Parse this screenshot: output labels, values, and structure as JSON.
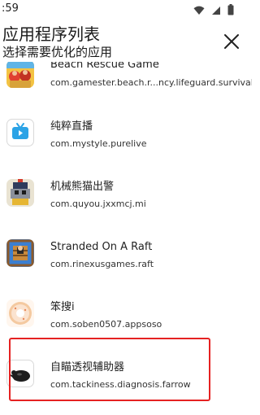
{
  "status_bar": {
    "time": ":59",
    "icons": [
      "wifi-icon",
      "signal-icon",
      "battery-icon"
    ]
  },
  "header": {
    "title": "应用程序列表",
    "subtitle": "选择需要优化的应用",
    "close_icon": "close-icon"
  },
  "apps": [
    {
      "name": "Beach Rescue Game",
      "package": "com.gamester.beach.r...ncy.lifeguard.survival",
      "icon": "beach-rescue-game-icon"
    },
    {
      "name": "纯粹直播",
      "package": "com.mystyle.purelive",
      "icon": "tv-icon"
    },
    {
      "name": "机械熊猫出警",
      "package": "com.quyou.jxxmcj.mi",
      "icon": "mech-panda-icon"
    },
    {
      "name": "Stranded On A Raft",
      "package": "com.rinexusgames.raft",
      "icon": "raft-icon"
    },
    {
      "name": "笨搜i",
      "package": "com.soben0507.appsoso",
      "icon": "donut-icon"
    },
    {
      "name": "自瞄透视辅助器",
      "package": "com.tackiness.diagnosis.farrow",
      "icon": "aim-assist-icon"
    }
  ],
  "colors": {
    "highlight": "#e52222",
    "tv_icon": "#2ba3e6"
  }
}
